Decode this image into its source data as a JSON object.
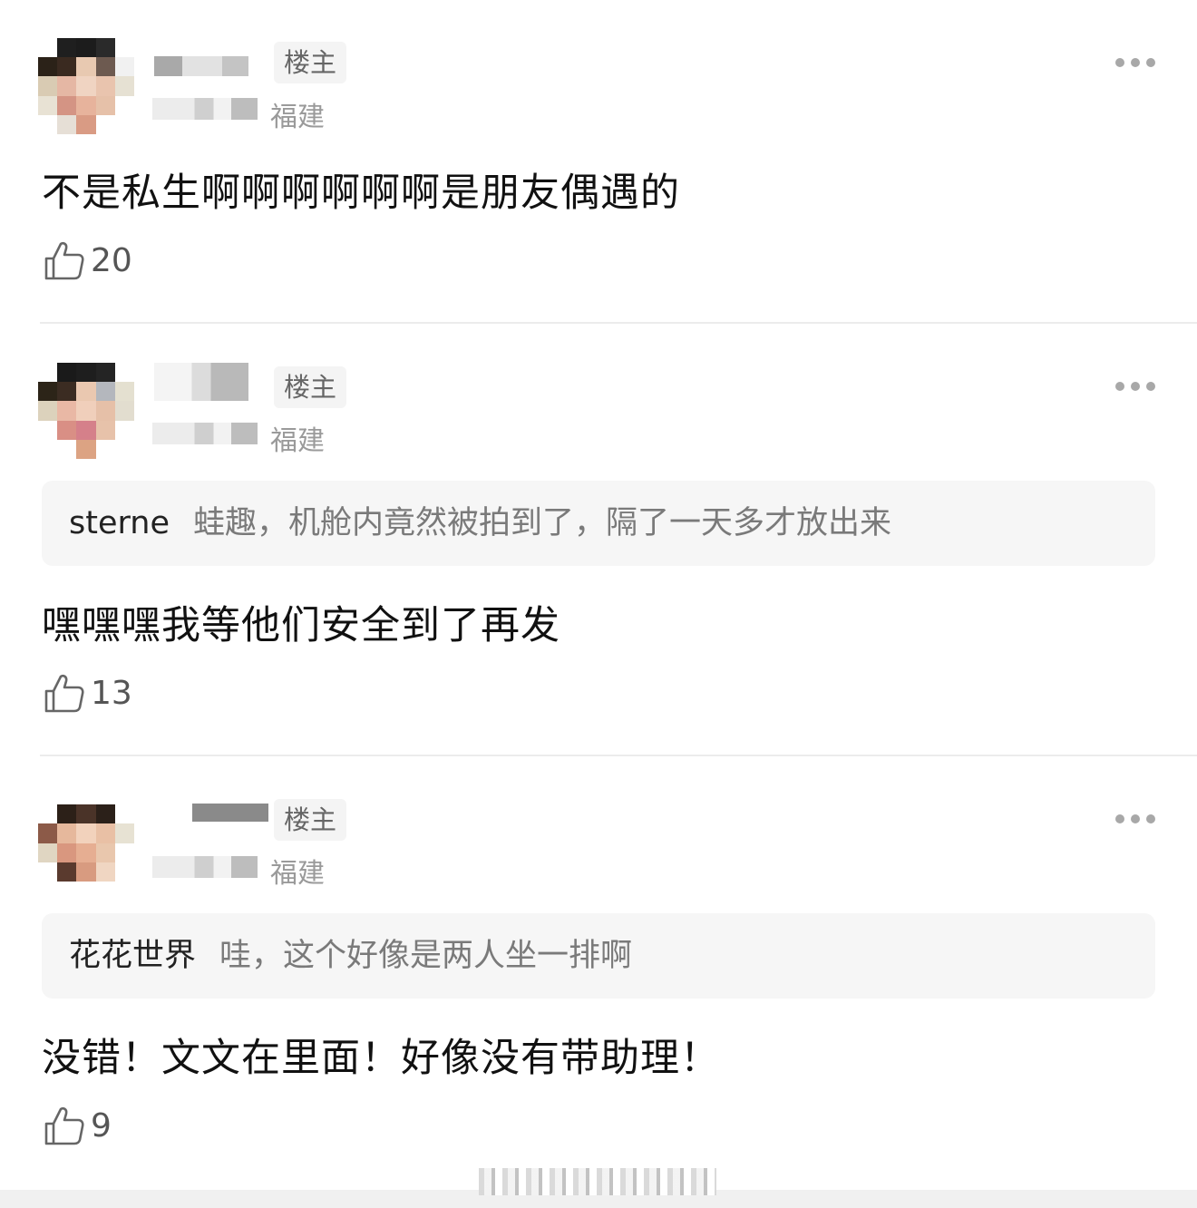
{
  "comments": [
    {
      "badge": "楼主",
      "region": "福建",
      "text": "不是私生啊啊啊啊啊啊是朋友偶遇的",
      "likes": "20"
    },
    {
      "badge": "楼主",
      "region": "福建",
      "quote": {
        "user": "sterne",
        "text": "蛙趣，机舱内竟然被拍到了，隔了一天多才放出来"
      },
      "text": "嘿嘿嘿我等他们安全到了再发",
      "likes": "13"
    },
    {
      "badge": "楼主",
      "region": "福建",
      "quote": {
        "user": "花花世界",
        "text": "哇，这个好像是两人坐一排啊"
      },
      "text": "没错！文文在里面！好像没有带助理！",
      "likes": "9"
    }
  ],
  "icons": {
    "more": "more-dots-icon",
    "like": "thumbs-up-icon"
  },
  "colors": {
    "badge_bg": "#f4f4f4",
    "muted_text": "#9a9a9a",
    "quote_bg": "#f6f6f6"
  }
}
